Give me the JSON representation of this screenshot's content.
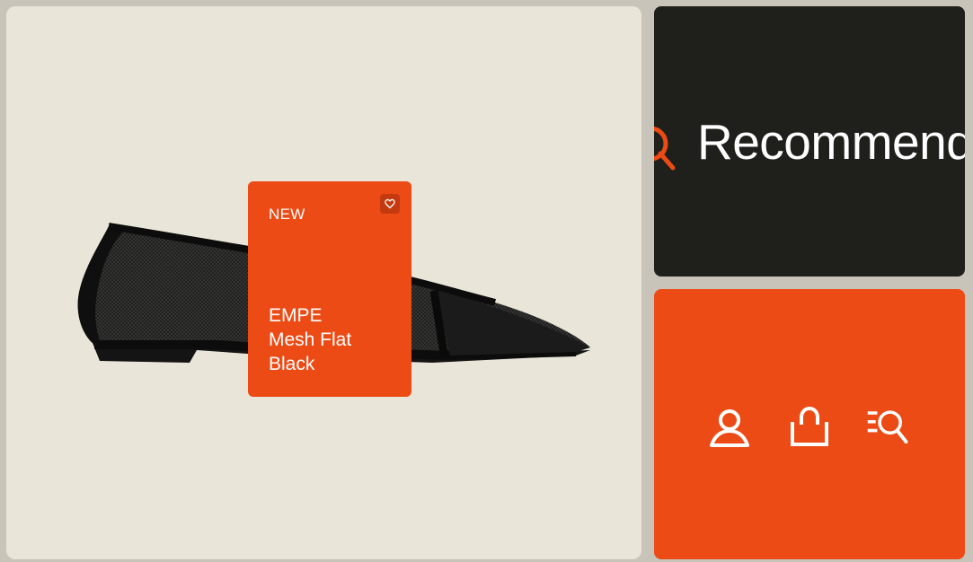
{
  "colors": {
    "background": "#c9c4b9",
    "hero_bg": "#e9e5d8",
    "accent": "#ec4b16",
    "dark": "#1f201c"
  },
  "product": {
    "badge": "NEW",
    "name_lines": [
      "EMPE",
      "Mesh Flat",
      "Black"
    ],
    "favorite_icon": "heart-icon"
  },
  "search": {
    "icon": "search-icon",
    "label": "Recommend"
  },
  "nav": {
    "items": [
      {
        "icon": "user-icon"
      },
      {
        "icon": "shopping-bag-icon"
      },
      {
        "icon": "list-search-icon"
      }
    ]
  }
}
